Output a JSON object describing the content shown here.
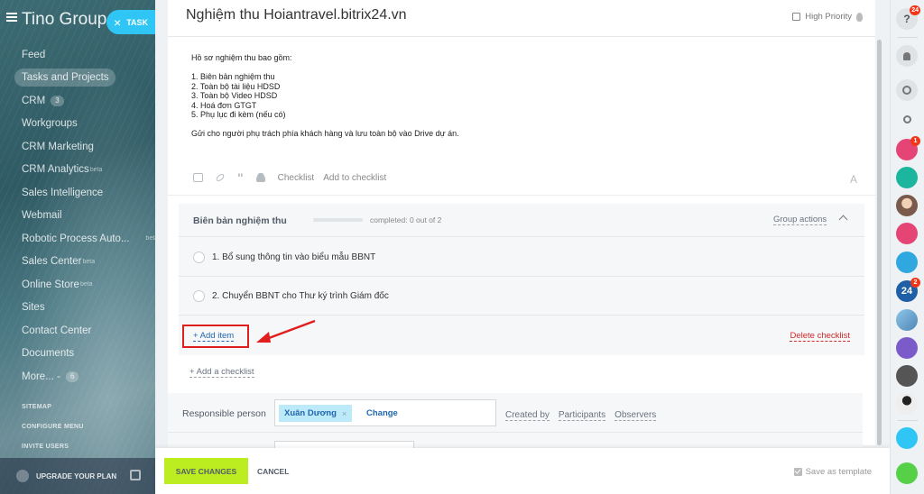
{
  "sidebar": {
    "company": "Tino Group",
    "task_pill": "TASK",
    "items": [
      {
        "label": "Feed"
      },
      {
        "label": "Tasks and Projects",
        "active": true
      },
      {
        "label": "CRM",
        "count": "3"
      },
      {
        "label": "Workgroups"
      },
      {
        "label": "CRM Marketing"
      },
      {
        "label": "CRM Analytics",
        "sup": "beta"
      },
      {
        "label": "Sales Intelligence"
      },
      {
        "label": "Webmail"
      },
      {
        "label": "Robotic Process Auto...",
        "sup": "beta"
      },
      {
        "label": "Sales Center",
        "sup": "beta"
      },
      {
        "label": "Online Store",
        "sup": "beta"
      },
      {
        "label": "Sites"
      },
      {
        "label": "Contact Center"
      },
      {
        "label": "Documents"
      },
      {
        "label": "More... -",
        "count": "6"
      }
    ],
    "small_links": [
      "SITEMAP",
      "CONFIGURE MENU",
      "INVITE USERS"
    ],
    "upgrade": "UPGRADE YOUR PLAN"
  },
  "task": {
    "title": "Nghiệm thu Hoiantravel.bitrix24.vn",
    "high_priority": "High Priority",
    "description": [
      "Hồ sơ nghiệm thu bao gồm:",
      "",
      "1. Biên bản nghiệm thu",
      "2. Toàn bộ tài liệu HDSD",
      "3. Toàn bộ Video HDSD",
      "4. Hoá đơn GTGT",
      "5. Phụ lục đi kèm (nếu có)",
      "",
      "Gửi cho người phụ trách phía khách hàng và lưu toàn bộ vào Drive dự án."
    ],
    "toolbar": {
      "checklist": "Checklist",
      "add_to_checklist": "Add to checklist",
      "font_icon": "A"
    }
  },
  "checklist": {
    "title": "Biên bản nghiệm thu",
    "completed": "completed: 0 out of 2",
    "progress": 0,
    "group_actions": "Group actions",
    "items": [
      {
        "label": "1. Bổ sung thông tin vào biểu mẫu BBNT",
        "done": false
      },
      {
        "label": "2. Chuyển BBNT cho Thư ký trình Giám đốc",
        "done": false
      }
    ],
    "add_item": "+ Add item",
    "delete_checklist": "Delete checklist",
    "add_checklist": "+ Add a checklist"
  },
  "responsible": {
    "label": "Responsible person",
    "person": "Xuân Dương",
    "remove": "×",
    "change": "Change",
    "links": [
      "Created by",
      "Participants",
      "Observers"
    ]
  },
  "footer": {
    "save": "SAVE CHANGES",
    "cancel": "CANCEL",
    "save_template": "Save as template"
  },
  "rightbar": {
    "help_badge": "24",
    "avatar_badge": "1",
    "b24_label": "24",
    "b24_badge": "2"
  },
  "colors": {
    "accent_green": "#bbed21",
    "link_blue": "#2067b0",
    "task_pill": "#2fc6f6",
    "highlight_red": "#e01e1e"
  }
}
